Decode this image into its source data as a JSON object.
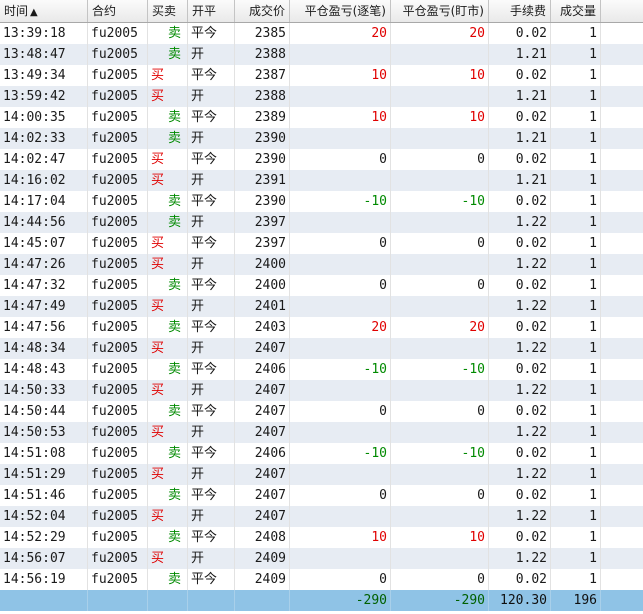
{
  "header": {
    "time": "时间",
    "contract": "合约",
    "side": "买卖",
    "open_close": "开平",
    "price": "成交价",
    "pnl_trade": "平仓盈亏(逐笔)",
    "pnl_mtm": "平仓盈亏(盯市)",
    "fee": "手续费",
    "volume": "成交量"
  },
  "sort_indicator": "▲",
  "rows": [
    {
      "time": "13:39:18",
      "contract": "fu2005",
      "side": "卖",
      "oc": "平今",
      "price": "2385",
      "pnl1": "20",
      "pnl2": "20",
      "fee": "0.02",
      "vol": "1"
    },
    {
      "time": "13:48:47",
      "contract": "fu2005",
      "side": "卖",
      "oc": "开",
      "price": "2388",
      "pnl1": "",
      "pnl2": "",
      "fee": "1.21",
      "vol": "1"
    },
    {
      "time": "13:49:34",
      "contract": "fu2005",
      "side": "买",
      "oc": "平今",
      "price": "2387",
      "pnl1": "10",
      "pnl2": "10",
      "fee": "0.02",
      "vol": "1"
    },
    {
      "time": "13:59:42",
      "contract": "fu2005",
      "side": "买",
      "oc": "开",
      "price": "2388",
      "pnl1": "",
      "pnl2": "",
      "fee": "1.21",
      "vol": "1"
    },
    {
      "time": "14:00:35",
      "contract": "fu2005",
      "side": "卖",
      "oc": "平今",
      "price": "2389",
      "pnl1": "10",
      "pnl2": "10",
      "fee": "0.02",
      "vol": "1"
    },
    {
      "time": "14:02:33",
      "contract": "fu2005",
      "side": "卖",
      "oc": "开",
      "price": "2390",
      "pnl1": "",
      "pnl2": "",
      "fee": "1.21",
      "vol": "1"
    },
    {
      "time": "14:02:47",
      "contract": "fu2005",
      "side": "买",
      "oc": "平今",
      "price": "2390",
      "pnl1": "0",
      "pnl2": "0",
      "fee": "0.02",
      "vol": "1"
    },
    {
      "time": "14:16:02",
      "contract": "fu2005",
      "side": "买",
      "oc": "开",
      "price": "2391",
      "pnl1": "",
      "pnl2": "",
      "fee": "1.21",
      "vol": "1"
    },
    {
      "time": "14:17:04",
      "contract": "fu2005",
      "side": "卖",
      "oc": "平今",
      "price": "2390",
      "pnl1": "-10",
      "pnl2": "-10",
      "fee": "0.02",
      "vol": "1"
    },
    {
      "time": "14:44:56",
      "contract": "fu2005",
      "side": "卖",
      "oc": "开",
      "price": "2397",
      "pnl1": "",
      "pnl2": "",
      "fee": "1.22",
      "vol": "1"
    },
    {
      "time": "14:45:07",
      "contract": "fu2005",
      "side": "买",
      "oc": "平今",
      "price": "2397",
      "pnl1": "0",
      "pnl2": "0",
      "fee": "0.02",
      "vol": "1"
    },
    {
      "time": "14:47:26",
      "contract": "fu2005",
      "side": "买",
      "oc": "开",
      "price": "2400",
      "pnl1": "",
      "pnl2": "",
      "fee": "1.22",
      "vol": "1"
    },
    {
      "time": "14:47:32",
      "contract": "fu2005",
      "side": "卖",
      "oc": "平今",
      "price": "2400",
      "pnl1": "0",
      "pnl2": "0",
      "fee": "0.02",
      "vol": "1"
    },
    {
      "time": "14:47:49",
      "contract": "fu2005",
      "side": "买",
      "oc": "开",
      "price": "2401",
      "pnl1": "",
      "pnl2": "",
      "fee": "1.22",
      "vol": "1"
    },
    {
      "time": "14:47:56",
      "contract": "fu2005",
      "side": "卖",
      "oc": "平今",
      "price": "2403",
      "pnl1": "20",
      "pnl2": "20",
      "fee": "0.02",
      "vol": "1"
    },
    {
      "time": "14:48:34",
      "contract": "fu2005",
      "side": "买",
      "oc": "开",
      "price": "2407",
      "pnl1": "",
      "pnl2": "",
      "fee": "1.22",
      "vol": "1"
    },
    {
      "time": "14:48:43",
      "contract": "fu2005",
      "side": "卖",
      "oc": "平今",
      "price": "2406",
      "pnl1": "-10",
      "pnl2": "-10",
      "fee": "0.02",
      "vol": "1"
    },
    {
      "time": "14:50:33",
      "contract": "fu2005",
      "side": "买",
      "oc": "开",
      "price": "2407",
      "pnl1": "",
      "pnl2": "",
      "fee": "1.22",
      "vol": "1"
    },
    {
      "time": "14:50:44",
      "contract": "fu2005",
      "side": "卖",
      "oc": "平今",
      "price": "2407",
      "pnl1": "0",
      "pnl2": "0",
      "fee": "0.02",
      "vol": "1"
    },
    {
      "time": "14:50:53",
      "contract": "fu2005",
      "side": "买",
      "oc": "开",
      "price": "2407",
      "pnl1": "",
      "pnl2": "",
      "fee": "1.22",
      "vol": "1"
    },
    {
      "time": "14:51:08",
      "contract": "fu2005",
      "side": "卖",
      "oc": "平今",
      "price": "2406",
      "pnl1": "-10",
      "pnl2": "-10",
      "fee": "0.02",
      "vol": "1"
    },
    {
      "time": "14:51:29",
      "contract": "fu2005",
      "side": "买",
      "oc": "开",
      "price": "2407",
      "pnl1": "",
      "pnl2": "",
      "fee": "1.22",
      "vol": "1"
    },
    {
      "time": "14:51:46",
      "contract": "fu2005",
      "side": "卖",
      "oc": "平今",
      "price": "2407",
      "pnl1": "0",
      "pnl2": "0",
      "fee": "0.02",
      "vol": "1"
    },
    {
      "time": "14:52:04",
      "contract": "fu2005",
      "side": "买",
      "oc": "开",
      "price": "2407",
      "pnl1": "",
      "pnl2": "",
      "fee": "1.22",
      "vol": "1"
    },
    {
      "time": "14:52:29",
      "contract": "fu2005",
      "side": "卖",
      "oc": "平今",
      "price": "2408",
      "pnl1": "10",
      "pnl2": "10",
      "fee": "0.02",
      "vol": "1"
    },
    {
      "time": "14:56:07",
      "contract": "fu2005",
      "side": "买",
      "oc": "开",
      "price": "2409",
      "pnl1": "",
      "pnl2": "",
      "fee": "1.22",
      "vol": "1"
    },
    {
      "time": "14:56:19",
      "contract": "fu2005",
      "side": "卖",
      "oc": "平今",
      "price": "2409",
      "pnl1": "0",
      "pnl2": "0",
      "fee": "0.02",
      "vol": "1"
    }
  ],
  "totals": {
    "pnl1": "-290",
    "pnl2": "-290",
    "fee": "120.30",
    "vol": "196"
  },
  "colors": {
    "buy": "#e00000",
    "sell": "#008a00",
    "row_alt": "#e7ecf3",
    "total_bg": "#8fc3e6"
  }
}
